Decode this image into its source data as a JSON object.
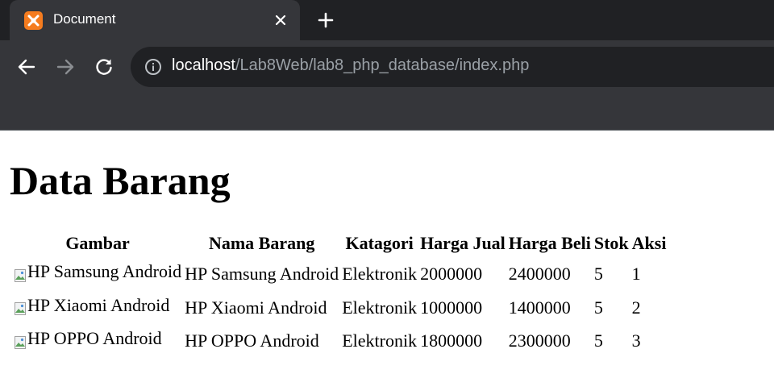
{
  "browser": {
    "tab_title": "Document",
    "url_host": "localhost",
    "url_path": "/Lab8Web/lab8_php_database/index.php",
    "icons": {
      "favicon": "xampp-icon",
      "close": "close-icon",
      "new_tab": "plus-icon",
      "back": "arrow-left-icon",
      "forward": "arrow-right-icon",
      "reload": "reload-icon",
      "site_info": "info-icon"
    }
  },
  "page": {
    "title": "Data Barang",
    "table": {
      "headers": [
        "Gambar",
        "Nama Barang",
        "Katagori",
        "Harga Jual",
        "Harga Beli",
        "Stok",
        "Aksi"
      ],
      "rows": [
        {
          "gambar_alt": "HP Samsung Android",
          "nama": "HP Samsung Android",
          "kategori": "Elektronik",
          "harga_jual": "2000000",
          "harga_beli": "2400000",
          "stok": "5",
          "aksi": "1"
        },
        {
          "gambar_alt": "HP Xiaomi Android",
          "nama": "HP Xiaomi Android",
          "kategori": "Elektronik",
          "harga_jual": "1000000",
          "harga_beli": "1400000",
          "stok": "5",
          "aksi": "2"
        },
        {
          "gambar_alt": "HP OPPO Android",
          "nama": "HP OPPO Android",
          "kategori": "Elektronik",
          "harga_jual": "1800000",
          "harga_beli": "2300000",
          "stok": "5",
          "aksi": "3"
        }
      ]
    }
  },
  "colors": {
    "chrome_bg": "#35363a",
    "tab_strip_bg": "#202124",
    "omnibox_bg": "#202124",
    "url_path": "#9aa0a6",
    "favicon": "#f57c1f"
  }
}
